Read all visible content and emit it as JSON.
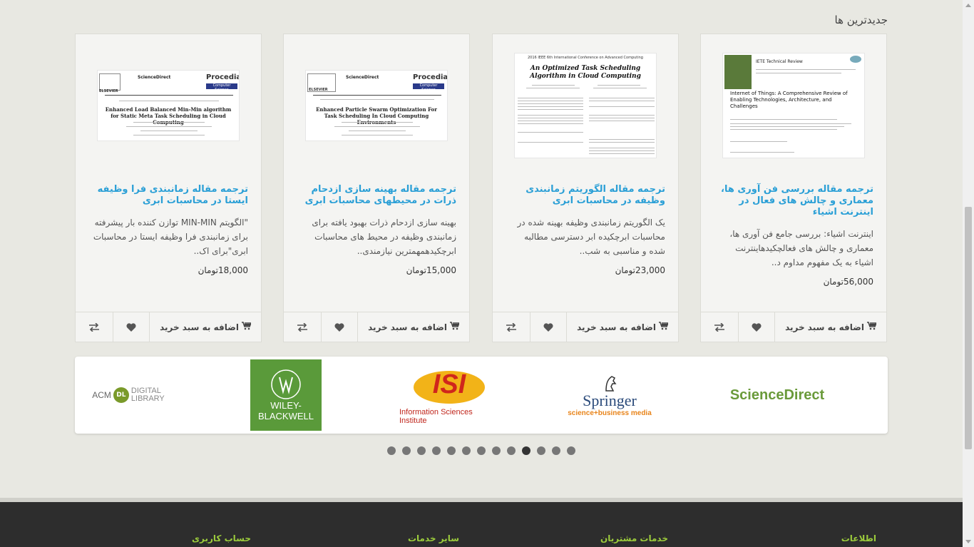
{
  "section": {
    "title": "جدیدترین ها"
  },
  "cards": [
    {
      "title": "ترجمه مقاله بررسی فن آوری ها، معماری و چالش های فعال در اینترنت اشیاء",
      "desc": "اینترنت اشیاء: بررسی جامع فن آوری ها، معماری و چالش های فعالچکیدهاینترنت اشیاء به یک مفهوم مداوم د..",
      "price": "56,000تومان",
      "add_label": "اضافه به سبد خرید",
      "thumb_title": "Internet of Things: A Comprehensive Review of Enabling Technologies, Architecture, and Challenges",
      "thumb_header": "IETE Technical Review"
    },
    {
      "title": "ترجمه مقاله الگوریتم زمانبندی وظیفه در محاسبات ابری",
      "desc": "یک الگوریتم زمانبندی وظیفه بهینه شده در محاسبات ابرچکیده ابر دسترسی مطالبه شده و مناسبی به شب..",
      "price": "23,000تومان",
      "add_label": "اضافه به سبد خرید",
      "thumb_title": "An Optimized Task Scheduling Algorithm in Cloud Computing",
      "thumb_header": "2016 IEEE 6th International Conference on Advanced Computing"
    },
    {
      "title": "ترجمه مقاله بهینه سازی ازدحام ذرات در محیطهای محاسبات ابری",
      "desc": "بهینه سازی ازدحام ذرات بهبود یافته برای زمانبندی وظیفه در محیط های محاسبات ابرچکیدهمهمترین نیازمندی..",
      "price": "15,000تومان",
      "add_label": "اضافه به سبد خرید",
      "thumb_title": "Enhanced Particle Swarm Optimization For Task Scheduling In Cloud Computing Environments",
      "thumb_header": "ScienceDirect"
    },
    {
      "title": "ترجمه مقاله زمانبندی فرا وظیفه ایستا در محاسبات ابری",
      "desc": "\"الگویتم MIN-MIN توازن کننده بار پیشرفته برای زمانبندی فرا وظیفه ایستا در محاسبات ابری\"برای اک..",
      "price": "18,000تومان",
      "add_label": "اضافه به سبد خرید",
      "thumb_title": "Enhanced Load Balanced Min-Min algorithm for Static Meta Task Scheduling in Cloud Computing",
      "thumb_header": "ScienceDirect"
    }
  ],
  "brands": {
    "sciencedirect": "ScienceDirect",
    "springer": "Springer",
    "springer_tag": "science+business media",
    "isi": "ISI",
    "isi_tag": "Information Sciences Institute",
    "wiley_1": "WILEY-",
    "wiley_2": "BLACKWELL",
    "acm_1": "ACM",
    "acm_dl": "DL",
    "acm_2": "DIGITAL",
    "acm_3": "LIBRARY"
  },
  "carousel": {
    "dot_count": 13,
    "active_index": 9
  },
  "footer": {
    "info": "اطلاعات",
    "customer": "خدمات مشتریان",
    "other": "سایر خدمات",
    "account": "حساب کاربری"
  },
  "thumb_labels": {
    "procedia": "Procedia",
    "computer_science": "Computer Science",
    "elsevier": "ELSEVIER"
  },
  "colors": {
    "link": "#2a9fd6",
    "footer_heading": "#9ccc3c",
    "sciencedirect_green": "#6a9a3a"
  }
}
